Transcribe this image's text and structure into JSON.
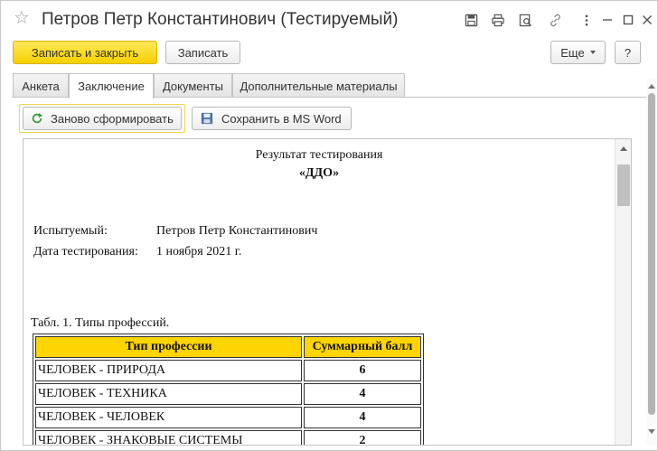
{
  "window": {
    "title": "Петров Петр Константинович (Тестируемый)",
    "star_icon": "star-icon",
    "title_icons": [
      "save-icon",
      "print-icon",
      "preview-icon",
      "link-icon",
      "more-icon",
      "minimize-icon",
      "maximize-icon",
      "close-icon"
    ]
  },
  "toolbar": {
    "save_close_label": "Записать и закрыть",
    "save_label": "Записать",
    "more_label": "Еще",
    "help_label": "?"
  },
  "tabs": [
    {
      "label": "Анкета",
      "active": false
    },
    {
      "label": "Заключение",
      "active": true
    },
    {
      "label": "Документы",
      "active": false
    },
    {
      "label": "Дополнительные материалы",
      "active": false
    }
  ],
  "panel": {
    "regenerate_label": "Заново сформировать",
    "save_word_label": "Сохранить в MS Word"
  },
  "report": {
    "title": "Результат тестирования",
    "subtitle": "«ДДО»",
    "subject_label": "Испытуемый:",
    "subject_value": "Петров Петр Константинович",
    "date_label": "Дата тестирования:",
    "date_value": "1 ноября 2021 г.",
    "table_caption": "Табл. 1. Типы профессий.",
    "table_headers": [
      "Тип профессии",
      "Суммарный балл"
    ],
    "rows": [
      {
        "name": "ЧЕЛОВЕК - ПРИРОДА",
        "score": "6"
      },
      {
        "name": "ЧЕЛОВЕК - ТЕХНИКА",
        "score": "4"
      },
      {
        "name": "ЧЕЛОВЕК - ЧЕЛОВЕК",
        "score": "4"
      },
      {
        "name": "ЧЕЛОВЕК - ЗНАКОВЫЕ СИСТЕМЫ",
        "score": "2"
      }
    ]
  },
  "colors": {
    "accent_yellow": "#f6d000",
    "header_fill": "#ffd500",
    "focus_border": "#f0d44a"
  }
}
